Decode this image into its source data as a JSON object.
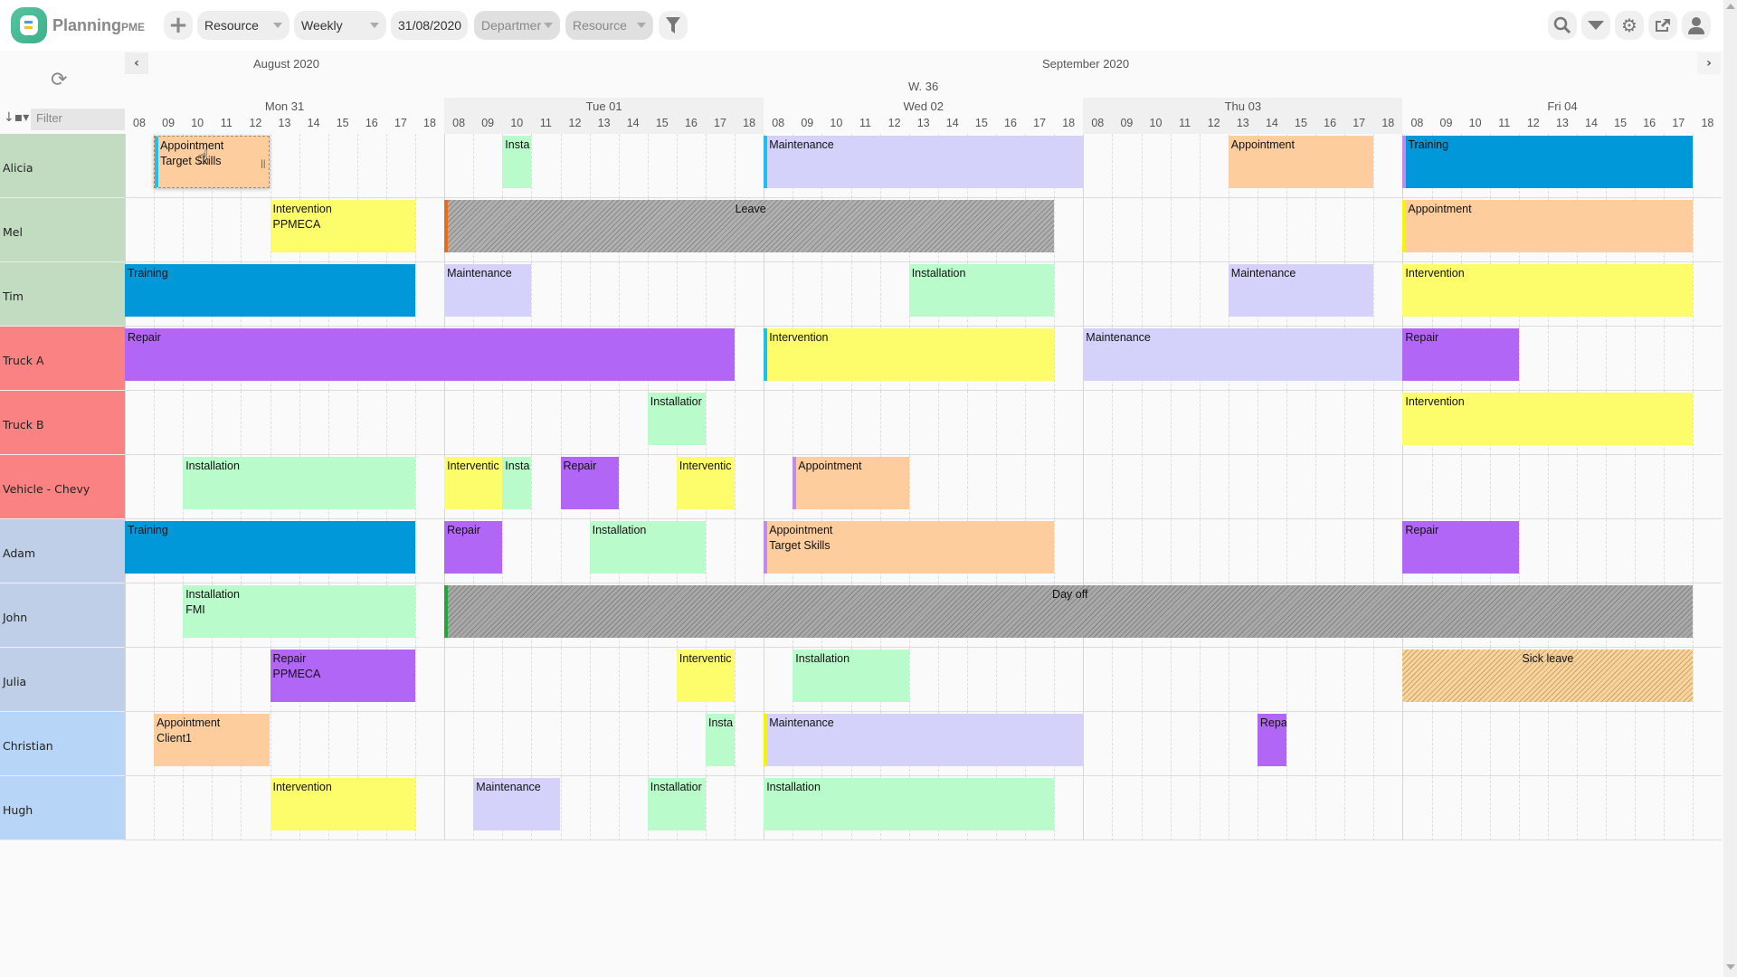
{
  "app": {
    "name": "Planning",
    "name_suffix": "PME"
  },
  "toolbar": {
    "add_icon": "plus-icon",
    "view_by": "Resource",
    "period": "Weekly",
    "date": "31/08/2020",
    "department": "Departmer",
    "resource_filter": "Resource",
    "filter_icon": "funnel-icon",
    "right_icons": [
      "search-icon",
      "dropdown-icon",
      "gear-icon",
      "export-icon",
      "user-icon"
    ]
  },
  "left_header": {
    "refresh_icon": "refresh-icon",
    "sort_icon": "sort-icon",
    "filter_placeholder": "Filter"
  },
  "calendar": {
    "months": [
      "August 2020",
      "September 2020"
    ],
    "week": "W. 36",
    "prev_icon": "‹",
    "next_icon": "›",
    "days": [
      {
        "label": "Mon 31",
        "alt": false
      },
      {
        "label": "Tue 01",
        "alt": true
      },
      {
        "label": "Wed 02",
        "alt": false
      },
      {
        "label": "Thu 03",
        "alt": true
      },
      {
        "label": "Fri 04",
        "alt": false
      }
    ],
    "hours": [
      "08",
      "09",
      "10",
      "11",
      "12",
      "13",
      "14",
      "15",
      "16",
      "17",
      "18"
    ]
  },
  "colors": {
    "Appointment": "#fdcd9e",
    "Installation": "#b9fbca",
    "Maintenance": "#d4d2fa",
    "Training": "#0098d8",
    "Intervention": "#fdfd6b",
    "Repair": "#b266f6",
    "Leave": "#b0b0b0",
    "Day off": "#a9a9a9",
    "Sick leave": "#fbd49a"
  },
  "resources": [
    {
      "name": "Alicia",
      "color": "#c2dcc2",
      "events": [
        {
          "type": "Appointment",
          "label": "Appointment",
          "sub": "Target Skills",
          "day": 0,
          "start": 1,
          "end": 5,
          "bar": "#1ec0f0",
          "selected": true
        },
        {
          "type": "Installation",
          "label": "Insta",
          "day": 1,
          "start": 2,
          "end": 3
        },
        {
          "type": "Maintenance",
          "label": "Maintenance",
          "day": 2,
          "start": 0,
          "end": 11,
          "bar": "#1ec0f0"
        },
        {
          "type": "Appointment",
          "label": "Appointment",
          "day": 3,
          "start": 5,
          "end": 10
        },
        {
          "type": "Training",
          "label": "Training",
          "day": 4,
          "start": 0,
          "end": 10,
          "bar": "#c08af0"
        }
      ]
    },
    {
      "name": "Mel",
      "color": "#c2dcc2",
      "events": [
        {
          "type": "Intervention",
          "label": "Intervention",
          "sub": "PPMECA",
          "day": 0,
          "start": 5,
          "end": 10
        },
        {
          "type": "Leave",
          "label": "Leave",
          "day": 1,
          "start": 0,
          "end": 21,
          "bar": "#e86c1c",
          "hatch": true
        },
        {
          "type": "Appointment",
          "label": "Appointment",
          "day": 4,
          "start": 0,
          "end": 10,
          "bar": "#f5f500"
        }
      ]
    },
    {
      "name": "Tim",
      "color": "#c2dcc2",
      "events": [
        {
          "type": "Training",
          "label": "Training",
          "day": 0,
          "start": 0,
          "end": 10
        },
        {
          "type": "Maintenance",
          "label": "Maintenance",
          "day": 1,
          "start": 0,
          "end": 3
        },
        {
          "type": "Installation",
          "label": "Installation",
          "day": 2,
          "start": 5,
          "end": 10
        },
        {
          "type": "Maintenance",
          "label": "Maintenance",
          "day": 3,
          "start": 5,
          "end": 10
        },
        {
          "type": "Intervention",
          "label": "Intervention",
          "day": 4,
          "start": 0,
          "end": 10
        }
      ]
    },
    {
      "name": "Truck A",
      "color": "#fa8282",
      "events": [
        {
          "type": "Repair",
          "label": "Repair",
          "day": 0,
          "start": 0,
          "end": 21
        },
        {
          "type": "Intervention",
          "label": "Intervention",
          "day": 2,
          "start": 0,
          "end": 10,
          "bar": "#1ec0f0"
        },
        {
          "type": "Maintenance",
          "label": "Maintenance",
          "day": 3,
          "start": 0,
          "end": 11
        },
        {
          "type": "Repair",
          "label": "Repair",
          "day": 4,
          "start": 0,
          "end": 4
        }
      ]
    },
    {
      "name": "Truck B",
      "color": "#fa8282",
      "events": [
        {
          "type": "Installation",
          "label": "Installatior",
          "day": 1,
          "start": 7,
          "end": 9
        },
        {
          "type": "Intervention",
          "label": "Intervention",
          "day": 4,
          "start": 0,
          "end": 10
        }
      ]
    },
    {
      "name": "Vehicle - Chevy",
      "color": "#fa8282",
      "events": [
        {
          "type": "Installation",
          "label": "Installation",
          "day": 0,
          "start": 2,
          "end": 10
        },
        {
          "type": "Intervention",
          "label": "Interventic",
          "day": 1,
          "start": 0,
          "end": 2
        },
        {
          "type": "Installation",
          "label": "Insta",
          "day": 1,
          "start": 2,
          "end": 3
        },
        {
          "type": "Repair",
          "label": "Repair",
          "day": 1,
          "start": 4,
          "end": 6
        },
        {
          "type": "Intervention",
          "label": "Interventic",
          "day": 1,
          "start": 8,
          "end": 10
        },
        {
          "type": "Appointment",
          "label": "Appointment",
          "day": 2,
          "start": 1,
          "end": 5,
          "bar": "#c08af0"
        }
      ]
    },
    {
      "name": "Adam",
      "color": "#bfcfe8",
      "events": [
        {
          "type": "Training",
          "label": "Training",
          "day": 0,
          "start": 0,
          "end": 10
        },
        {
          "type": "Repair",
          "label": "Repair",
          "day": 1,
          "start": 0,
          "end": 2
        },
        {
          "type": "Installation",
          "label": "Installation",
          "day": 1,
          "start": 5,
          "end": 9
        },
        {
          "type": "Appointment",
          "label": "Appointment",
          "sub": "Target Skills",
          "day": 2,
          "start": 0,
          "end": 10,
          "bar": "#c08af0"
        },
        {
          "type": "Repair",
          "label": "Repair",
          "day": 4,
          "start": 0,
          "end": 4
        }
      ]
    },
    {
      "name": "John",
      "color": "#bfcfe8",
      "events": [
        {
          "type": "Installation",
          "label": "Installation",
          "sub": "FMI",
          "day": 0,
          "start": 2,
          "end": 10
        },
        {
          "type": "Day off",
          "label": "Day off",
          "day": 1,
          "start": 0,
          "end": 43,
          "bar": "#22a83a",
          "hatch": true
        }
      ]
    },
    {
      "name": "Julia",
      "color": "#bfcfe8",
      "events": [
        {
          "type": "Repair",
          "label": "Repair",
          "sub": "PPMECA",
          "day": 0,
          "start": 5,
          "end": 10
        },
        {
          "type": "Intervention",
          "label": "Interventic",
          "day": 1,
          "start": 8,
          "end": 10
        },
        {
          "type": "Installation",
          "label": "Installation",
          "day": 2,
          "start": 1,
          "end": 5
        },
        {
          "type": "Sick leave",
          "label": "Sick leave",
          "day": 4,
          "start": 0,
          "end": 10,
          "hatch": true
        }
      ]
    },
    {
      "name": "Christian",
      "color": "#b7d5f7",
      "events": [
        {
          "type": "Appointment",
          "label": "Appointment",
          "sub": "Client1",
          "day": 0,
          "start": 1,
          "end": 5
        },
        {
          "type": "Installation",
          "label": "Insta",
          "day": 1,
          "start": 9,
          "end": 10
        },
        {
          "type": "Maintenance",
          "label": "Maintenance",
          "day": 2,
          "start": 0,
          "end": 11,
          "bar": "#f5f500"
        },
        {
          "type": "Repair",
          "label": "Repa",
          "day": 3,
          "start": 6,
          "end": 7
        }
      ]
    },
    {
      "name": "Hugh",
      "color": "#b7d5f7",
      "events": [
        {
          "type": "Intervention",
          "label": "Intervention",
          "day": 0,
          "start": 5,
          "end": 10
        },
        {
          "type": "Maintenance",
          "label": "Maintenance",
          "day": 1,
          "start": 1,
          "end": 4
        },
        {
          "type": "Installation",
          "label": "Installatior",
          "day": 1,
          "start": 7,
          "end": 9
        },
        {
          "type": "Installation",
          "label": "Installation",
          "day": 2,
          "start": 0,
          "end": 10
        }
      ]
    }
  ]
}
